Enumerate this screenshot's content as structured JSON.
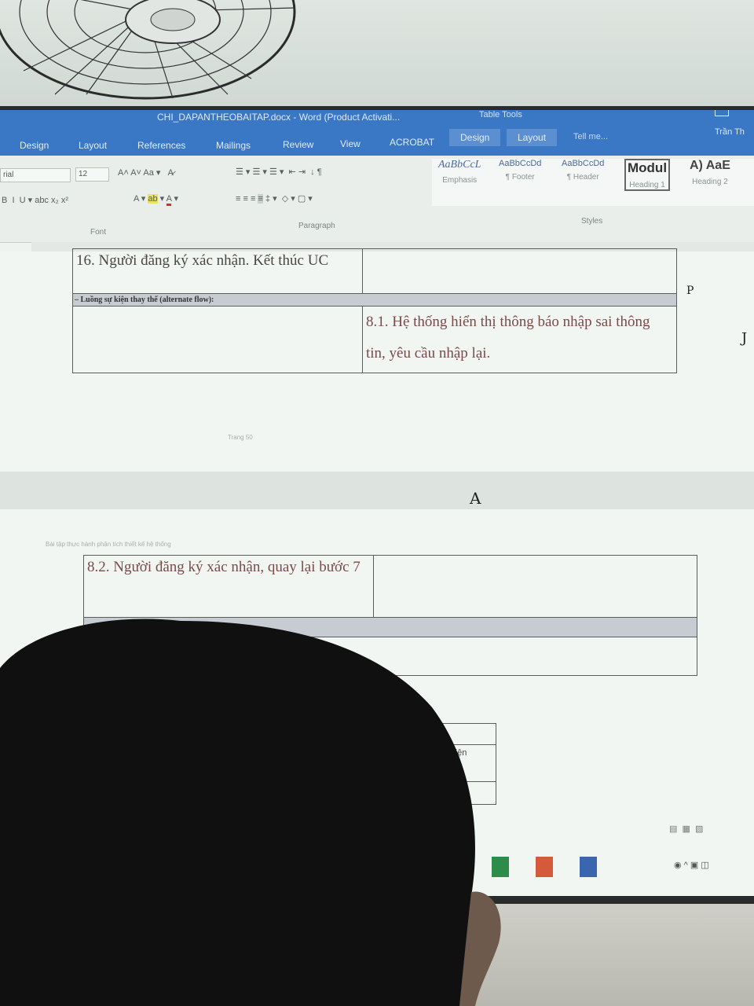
{
  "window": {
    "title": "CHI_DAPANTHEOBAITAP.docx - Word (Product Activati...",
    "context_label": "Table Tools",
    "user": "Trần Th"
  },
  "tabs": [
    "Design",
    "Layout",
    "References",
    "Mailings",
    "Review",
    "View",
    "ACROBAT",
    "Design",
    "Layout"
  ],
  "tell_me": "Tell me...",
  "ribbon": {
    "font_name": "rial",
    "font_size": "12",
    "group_font": "Font",
    "group_paragraph": "Paragraph",
    "group_styles": "Styles",
    "styles": [
      {
        "sample": "AaBbCcL",
        "name": "Emphasis"
      },
      {
        "sample": "AaBbCcDd",
        "name": "¶ Footer"
      },
      {
        "sample": "AaBbCcDd",
        "name": "¶ Header"
      },
      {
        "sample": "Modul",
        "name": "Heading 1"
      },
      {
        "sample": "A) AaE",
        "name": "Heading 2"
      }
    ]
  },
  "page1": {
    "row1_left": "16. Người đăng ký xác nhận. Kết thúc UC",
    "section_header": "– Luồng sự kiện thay thế (alternate flow):",
    "row2_right": "8.1. Hệ thống hiển thị thông báo nhập sai thông tin, yêu cầu nhập lại.",
    "footer": "Trang 50"
  },
  "page2": {
    "header_text": "Bài tập thực hành phân tích thiết kế hệ thống",
    "row1_left": "8.2. Người đăng ký xác nhận, quay lại bước 7",
    "small_table_cell": "n kiện"
  },
  "annotations": [
    "A",
    "J",
    "P"
  ]
}
